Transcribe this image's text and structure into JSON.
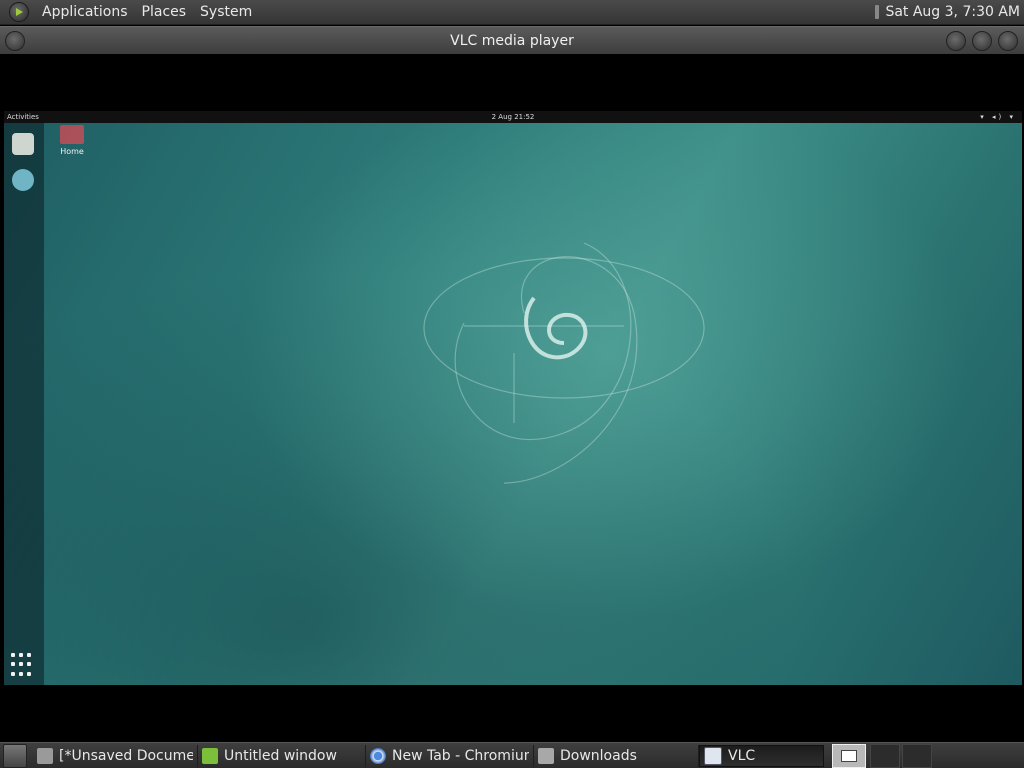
{
  "top_panel": {
    "menus": [
      "Applications",
      "Places",
      "System"
    ],
    "clock": "Sat Aug  3,  7:30 AM"
  },
  "window": {
    "title": "VLC media player"
  },
  "video_content": {
    "activities": "Activities",
    "clock": "2 Aug 21:52",
    "tray": "▾ ◂) ▾",
    "home_label": "Home"
  },
  "taskbar": {
    "tasks": [
      {
        "label": "[*Unsaved Docume...",
        "icon": "text-editor-icon"
      },
      {
        "label": "Untitled window",
        "icon": "glade-icon"
      },
      {
        "label": "New Tab - Chromium",
        "icon": "chromium-icon"
      },
      {
        "label": "Downloads",
        "icon": "folder-icon"
      },
      {
        "label": "VLC",
        "icon": "vlc-window-icon",
        "active": true
      }
    ]
  },
  "colors": {
    "panel": "#3f3f3f",
    "desktop_teal": "#2e7c7a",
    "home_folder": "#c24e57"
  }
}
